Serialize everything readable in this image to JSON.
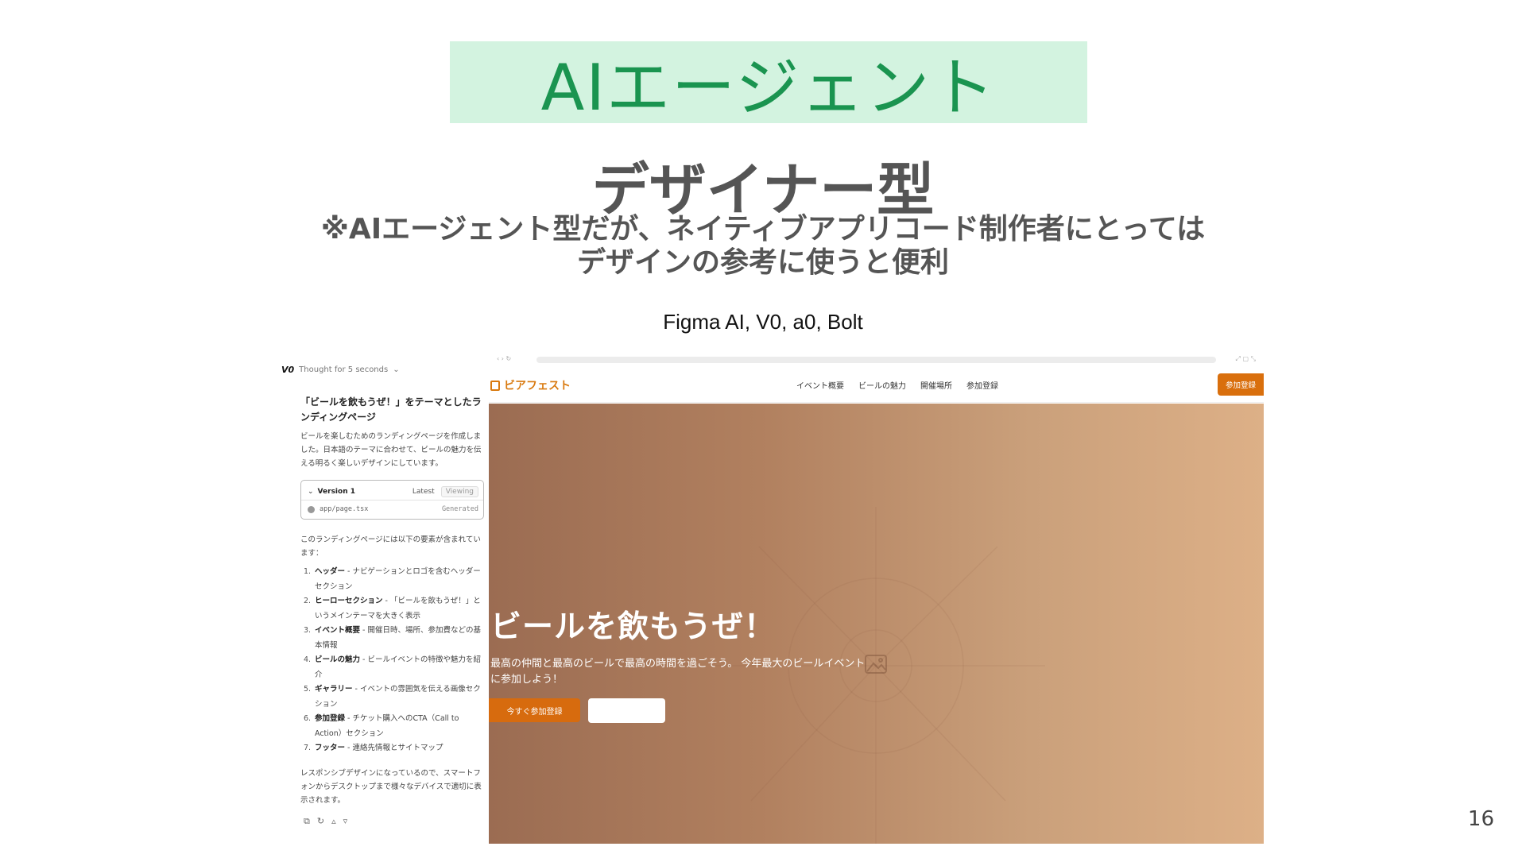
{
  "slide": {
    "title": "AIエージェント",
    "subtitle": "デザイナー型",
    "note_line1": "※AIエージェント型だが、ネイティブアプリコード制作者にとっては",
    "note_line2": "デザインの参考に使うと便利",
    "tools": "Figma AI, V0, a0, Bolt",
    "page_number": "16",
    "colors": {
      "title_bg": "#d3f3e0",
      "title_text": "#1a9450",
      "accent": "#d96f0d"
    }
  },
  "chat": {
    "logo": "V0",
    "thought": "Thought for 5 seconds",
    "heading": "「ビールを飲もうぜ！」をテーマとしたランディングページ",
    "intro": "ビールを楽しむためのランディングページを作成しました。日本語のテーマに合わせて、ビールの魅力を伝える明るく楽しいデザインにしています。",
    "version": {
      "label": "Version 1",
      "latest": "Latest",
      "viewing": "Viewing",
      "file": "app/page.tsx",
      "status": "Generated"
    },
    "list_intro": "このランディングページには以下の要素が含まれています：",
    "items": [
      {
        "num": "1.",
        "title": "ヘッダー",
        "desc": " - ナビゲーションとロゴを含むヘッダーセクション"
      },
      {
        "num": "2.",
        "title": "ヒーローセクション",
        "desc": " - 「ビールを飲もうぜ！」というメインテーマを大きく表示"
      },
      {
        "num": "3.",
        "title": "イベント概要",
        "desc": " - 開催日時、場所、参加費などの基本情報"
      },
      {
        "num": "4.",
        "title": "ビールの魅力",
        "desc": " - ビールイベントの特徴や魅力を紹介"
      },
      {
        "num": "5.",
        "title": "ギャラリー",
        "desc": " - イベントの雰囲気を伝える画像セクション"
      },
      {
        "num": "6.",
        "title": "参加登録",
        "desc": " - チケット購入へのCTA（Call to Action）セクション"
      },
      {
        "num": "7.",
        "title": "フッター",
        "desc": " - 連絡先情報とサイトマップ"
      }
    ],
    "outro": "レスポンシブデザインになっているので、スマートフォンからデスクトップまで様々なデバイスで適切に表示されます。",
    "actions": [
      "copy-icon",
      "retry-icon",
      "thumbs-up-icon",
      "thumbs-down-icon"
    ]
  },
  "site": {
    "brand": "ビアフェスト",
    "nav": [
      "イベント概要",
      "ビールの魅力",
      "開催場所",
      "参加登録"
    ],
    "nav_cta": "参加登録",
    "hero_title": "ビールを飲もうぜ！",
    "hero_sub": "最高の仲間と最高のビールで最高の時間を過ごそう。 今年最大のビールイベントに参加しよう！",
    "hero_btn_primary": "今すぐ参加登録",
    "hero_btn_secondary": ""
  }
}
